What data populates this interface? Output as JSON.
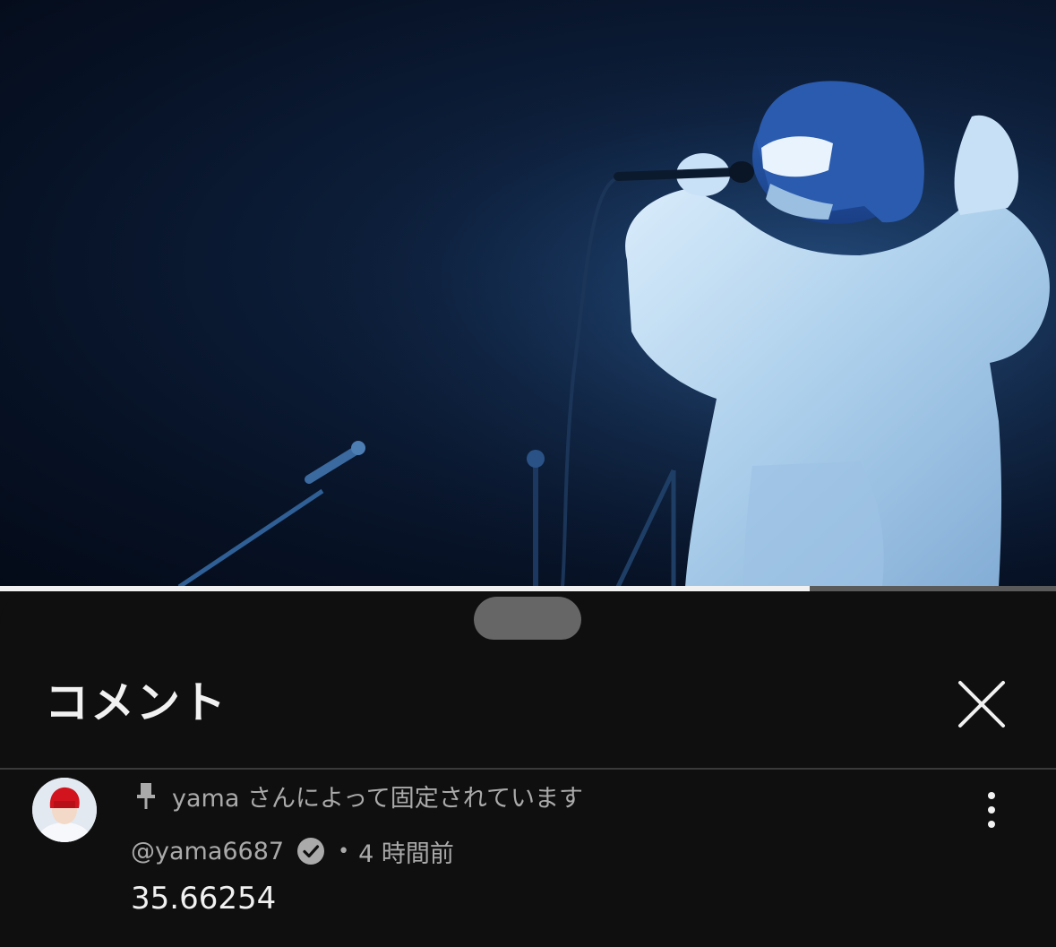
{
  "video": {
    "progress_fraction": 0.767,
    "content_icon": "concert-performer-video-frame"
  },
  "comments_panel": {
    "title": "コメント",
    "close_icon": "close-icon",
    "pinned_comment": {
      "pinned_label": "yama さんによって固定されています",
      "author": "@yama6687",
      "time_sep": "•",
      "time_ago": "4 時間前",
      "text": "35.66254",
      "avatar_icon": "avatar-red-hair",
      "pin_icon": "pin-icon",
      "verified_icon": "verified-check-icon",
      "more_icon": "more-vertical-icon"
    }
  },
  "colors": {
    "background": "#0f0f0f",
    "text_primary": "#f1f1f1",
    "text_secondary": "#aaaaaa",
    "progress_fill": "#f1f1f1",
    "progress_track": "#5a5a5a"
  }
}
